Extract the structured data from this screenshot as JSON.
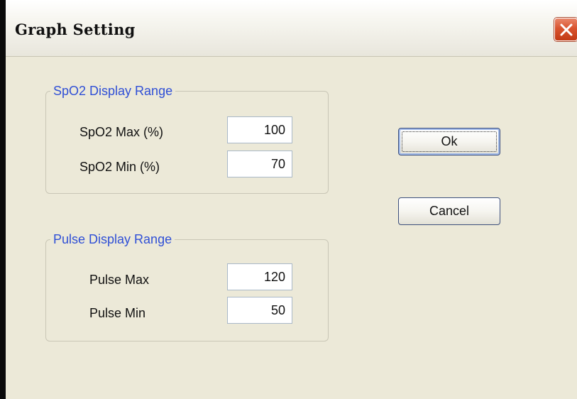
{
  "window": {
    "title": "Graph Setting",
    "close_icon": "close-icon"
  },
  "spo2_group": {
    "title": "SpO2 Display Range",
    "max_label": "SpO2 Max (%)",
    "max_value": "100",
    "min_label": "SpO2 Min (%)",
    "min_value": "70"
  },
  "pulse_group": {
    "title": "Pulse Display Range",
    "max_label": "Pulse Max",
    "max_value": "120",
    "min_label": "Pulse Min",
    "min_value": "50"
  },
  "buttons": {
    "ok_label": "Ok",
    "cancel_label": "Cancel"
  },
  "colors": {
    "group_title": "#2f4fd6",
    "dialog_bg": "#ece9d8",
    "close_button": "#d9542f"
  }
}
